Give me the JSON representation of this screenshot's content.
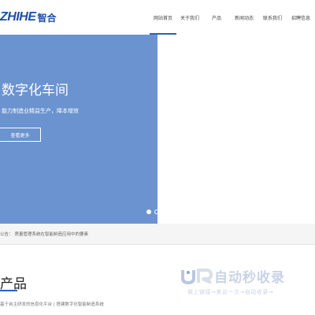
{
  "header": {
    "logo_text": "ZHIHE",
    "logo_cn": "智合",
    "nav": [
      {
        "label": "网站首页",
        "active": true
      },
      {
        "label": "关于我们",
        "active": false
      },
      {
        "label": "产品",
        "active": false
      },
      {
        "label": "新闻动态",
        "active": false
      },
      {
        "label": "联系我们",
        "active": false
      },
      {
        "label": "招聘信息",
        "active": false
      }
    ]
  },
  "banner": {
    "title": "数字化车间",
    "subtitle": "能力制造业精益生产，降本增效",
    "button_label": "查看更多",
    "slides": 2,
    "active_slide": 1
  },
  "notice": {
    "label": "公告：",
    "text": "质量管理系统在智能制造应用中的要素"
  },
  "products": {
    "title": "产品",
    "subtitle": "基于自主研发的信息化平台 | 搭建数字化智能制造系统"
  },
  "watermark": {
    "main": "自动秒收录",
    "sub": "做上链接→来访一次→自动收录→"
  },
  "colors": {
    "primary": "#2e5fbf",
    "banner_bg": "#6b93cf",
    "logo": "#1f4fa8"
  }
}
